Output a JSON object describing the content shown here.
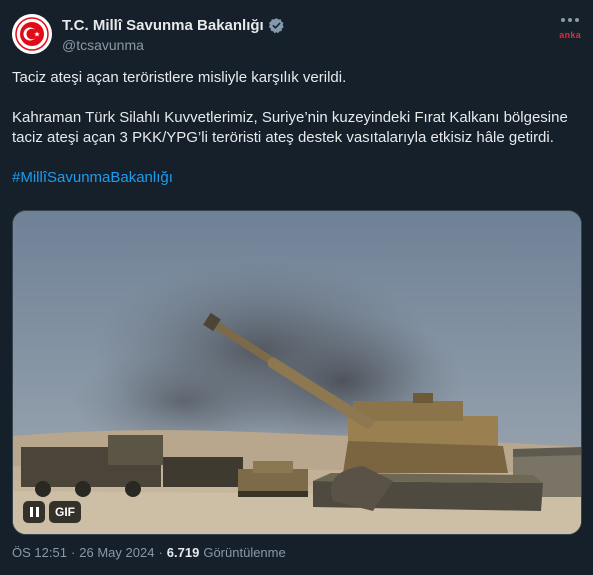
{
  "account": {
    "display_name": "T.C. Millî Savunma Bakanlığı",
    "handle": "@tcsavunma",
    "verified": true
  },
  "watermark": "anka",
  "tweet": {
    "line1": "Taciz ateşi açan teröristlere misliyle karşılık verildi.",
    "line2": "Kahraman Türk Silahlı Kuvvetlerimiz, Suriye’nin kuzeyindeki Fırat Kalkanı bölgesine taciz ateşi açan 3 PKK/YPG’li teröristi ateş destek vasıtalarıyla etkisiz hâle getirdi.",
    "hashtag": "#MillîSavunmaBakanlığı"
  },
  "media": {
    "gif_label": "GIF",
    "state": "playing"
  },
  "meta": {
    "time": "ÖS 12:51",
    "separator": "·",
    "date": "26 May 2024",
    "views_count": "6.719",
    "views_label": "Görüntülenme"
  },
  "colors": {
    "background": "#15202b",
    "text": "#e7e9ea",
    "muted": "#8b98a5",
    "link": "#1d9bf0",
    "verified": "#829aab",
    "watermark": "#e02a3c"
  }
}
